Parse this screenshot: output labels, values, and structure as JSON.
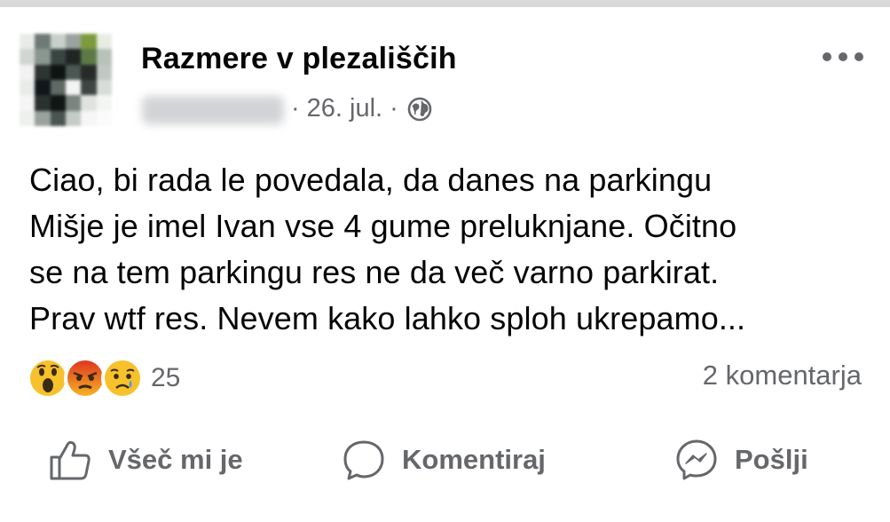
{
  "post": {
    "group_name": "Razmere v plezališčih",
    "date": "26. jul.",
    "separator": "·",
    "audience_icon": "public-globe-icon",
    "more_icon": "more-options-icon",
    "text_lines": [
      "Ciao, bi rada le povedala, da danes na parkingu",
      "Mišje je imel Ivan vse 4 gume preluknjane. Očitno",
      "se na tem parkingu res ne da več varno parkirat.",
      "Prav wtf res. Nevem kako lahko sploh ukrepamo..."
    ]
  },
  "reactions": {
    "icons": [
      "wow-reaction-icon",
      "angry-reaction-icon",
      "sad-reaction-icon"
    ],
    "count": "25"
  },
  "comments": {
    "label": "2 komentarja"
  },
  "actions": {
    "like": {
      "label": "Všeč mi je",
      "icon": "thumbs-up-icon"
    },
    "comment": {
      "label": "Komentiraj",
      "icon": "comment-bubble-icon"
    },
    "share": {
      "label": "Pošlji",
      "icon": "messenger-icon"
    }
  },
  "colors": {
    "text": "#050505",
    "secondary": "#65676b",
    "wow": "#f7b125",
    "angry": "#e9710f",
    "sad": "#f7b125"
  }
}
